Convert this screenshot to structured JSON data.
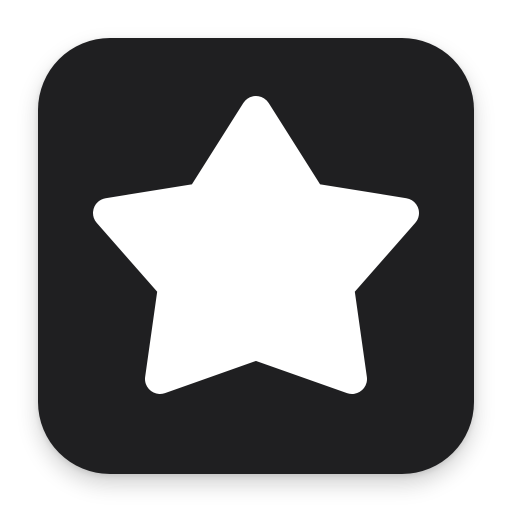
{
  "icon": {
    "name": "star-icon",
    "background_color": "#1f1f21",
    "glyph_color": "#ffffff"
  }
}
